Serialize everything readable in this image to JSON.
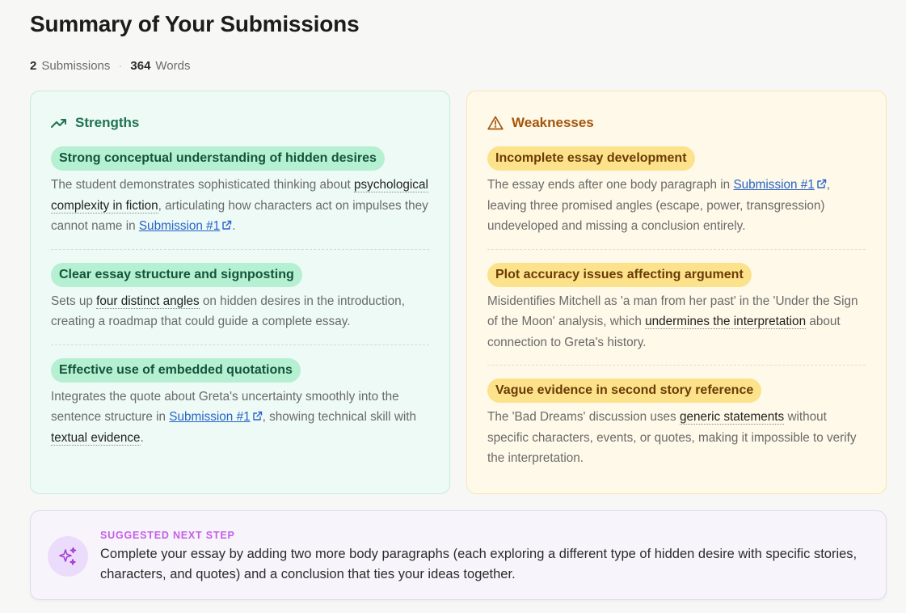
{
  "header": {
    "title": "Summary of Your Submissions",
    "submissions_count": "2",
    "submissions_label": "Submissions",
    "separator": "·",
    "words_count": "364",
    "words_label": "Words"
  },
  "strengths": {
    "title": "Strengths",
    "icon": "trending-up-icon",
    "color": "#1e7350",
    "items": [
      {
        "title": "Strong conceptual understanding of hidden desires",
        "t1": "The student demonstrates sophisticated thinking about ",
        "h1": "psychological complexity in fiction",
        "t2": ", articulating how characters act on impulses they cannot name in ",
        "link": "Submission #1",
        "t3": "."
      },
      {
        "title": "Clear essay structure and signposting",
        "t1": "Sets up ",
        "h1": "four distinct angles",
        "t2": " on hidden desires in the introduction, creating a roadmap that could guide a complete essay."
      },
      {
        "title": "Effective use of embedded quotations",
        "t1": "Integrates the quote about Greta's uncertainty smoothly into the sentence structure in ",
        "link": "Submission #1",
        "t2": ", showing technical skill with ",
        "h1": "textual evidence",
        "t3": "."
      }
    ]
  },
  "weaknesses": {
    "title": "Weaknesses",
    "icon": "warning-triangle-icon",
    "color": "#a5540b",
    "items": [
      {
        "title": "Incomplete essay development",
        "t1": "The essay ends after one body paragraph in ",
        "link": "Submission #1",
        "t2": ", leaving three promised angles (escape, power, transgression) undeveloped and missing a conclusion entirely."
      },
      {
        "title": "Plot accuracy issues affecting argument",
        "t1": "Misidentifies Mitchell as 'a man from her past' in the 'Under the Sign of the Moon' analysis, which ",
        "h1": "undermines the interpretation",
        "t2": " about connection to Greta's history."
      },
      {
        "title": "Vague evidence in second story reference",
        "t1": "The 'Bad Dreams' discussion uses ",
        "h1": "generic statements",
        "t2": " without specific characters, events, or quotes, making it impossible to verify the interpretation."
      }
    ]
  },
  "next_step": {
    "label": "SUGGESTED NEXT STEP",
    "icon": "sparkles-icon",
    "text": "Complete your essay by adding two more body paragraphs (each exploring a different type of hidden desire with specific stories, characters, and quotes) and a conclusion that ties your ideas together."
  }
}
